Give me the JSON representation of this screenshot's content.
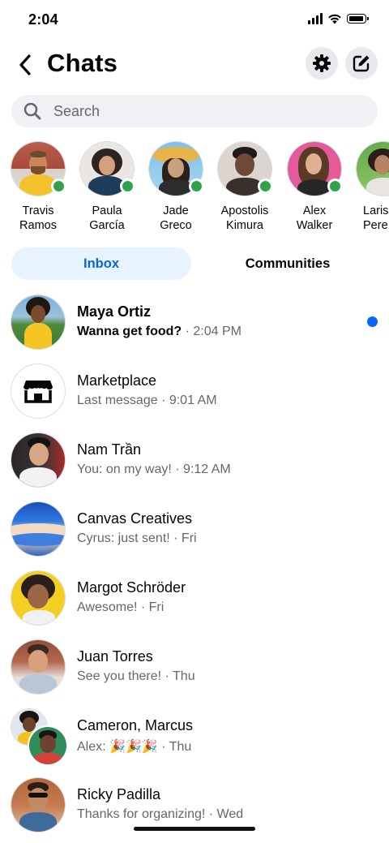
{
  "status_bar": {
    "time": "2:04"
  },
  "header": {
    "title": "Chats"
  },
  "search": {
    "placeholder": "Search"
  },
  "active_now": [
    {
      "name": "Travis\nRamos"
    },
    {
      "name": "Paula\nGarcía"
    },
    {
      "name": "Jade\nGreco"
    },
    {
      "name": "Apostolis\nKimura"
    },
    {
      "name": "Alex\nWalker"
    },
    {
      "name": "Laris\nPere"
    }
  ],
  "tabs": {
    "inbox": "Inbox",
    "communities": "Communities"
  },
  "chats": [
    {
      "name": "Maya Ortiz",
      "preview": "Wanna get food?",
      "time": "· 2:04 PM",
      "unread": true
    },
    {
      "name": "Marketplace",
      "preview": "Last message",
      "time": "· 9:01 AM"
    },
    {
      "name": "Nam Trần",
      "preview": "You: on my way!",
      "time": "· 9:12 AM"
    },
    {
      "name": "Canvas Creatives",
      "preview": "Cyrus: just sent!",
      "time": "· Fri"
    },
    {
      "name": "Margot Schröder",
      "preview": "Awesome!",
      "time": "· Fri"
    },
    {
      "name": "Juan Torres",
      "preview": "See you there!",
      "time": "· Thu"
    },
    {
      "name": "Cameron, Marcus",
      "preview": "Alex: 🎉🎉🎉",
      "time": "· Thu"
    },
    {
      "name": "Ricky Padilla",
      "preview": "Thanks for organizing!",
      "time": "· Wed"
    }
  ],
  "colors": {
    "accent": "#0866ff",
    "online": "#31a24c",
    "tab_bg": "#e7f3ff"
  }
}
